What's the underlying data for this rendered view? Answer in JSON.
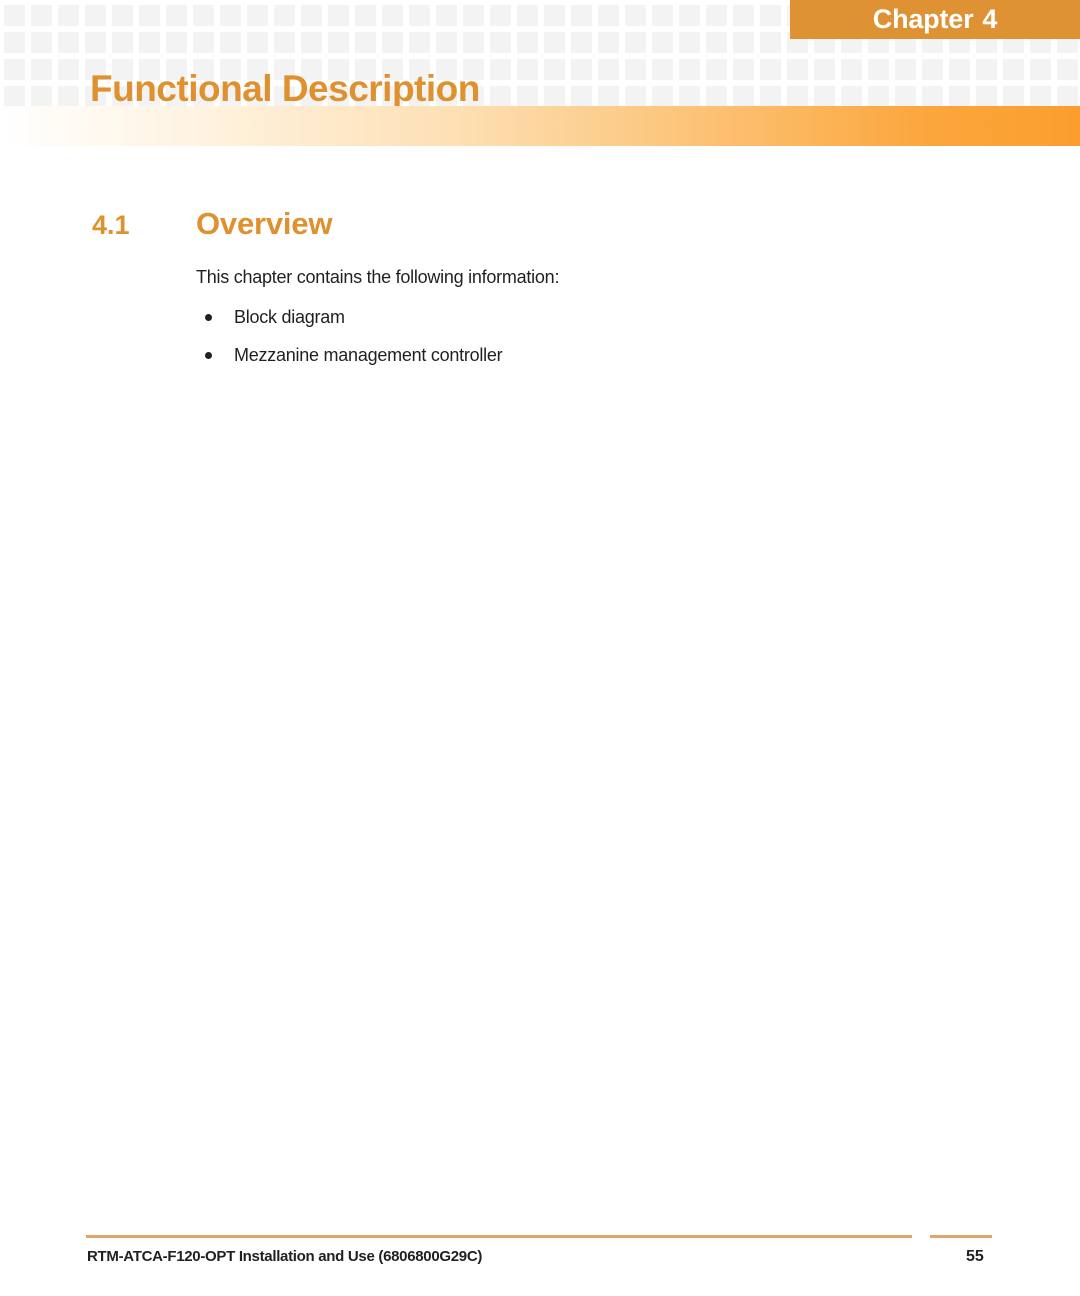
{
  "document": {
    "chapter_banner": {
      "label": "Chapter",
      "number": "4"
    },
    "chapter_title": "Functional Description",
    "section": {
      "number": "4.1",
      "title": "Overview"
    },
    "body": {
      "intro": "This chapter contains the following information:",
      "bullets": [
        "Block diagram",
        "Mezzanine management controller"
      ]
    },
    "footer": {
      "document_reference": "RTM-ATCA-F120-OPT Installation and Use (6806800G29C)",
      "page_number": "55"
    },
    "colors": {
      "banner_orange": "#de9233",
      "title_orange": "#e0912f",
      "band_orange": "#fb9e2e",
      "footer_rule": "#dca768",
      "body_text": "#231f20",
      "pattern_square": "#f3f3f3"
    }
  }
}
